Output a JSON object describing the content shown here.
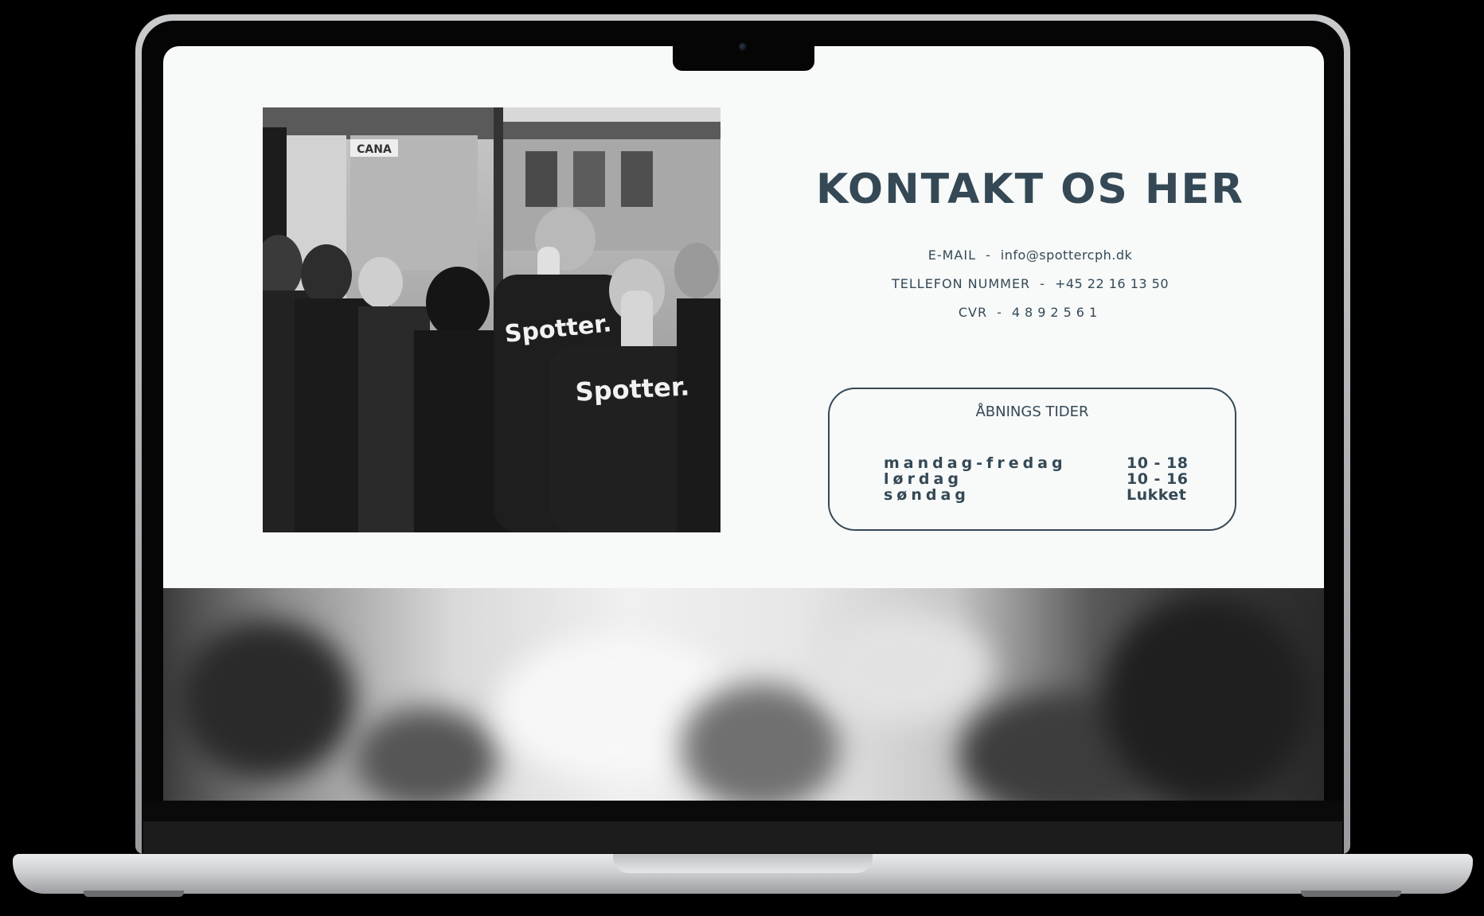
{
  "contact": {
    "title": "KONTAKT OS HER",
    "email_label": "E-MAIL",
    "email_value": "info@spottercph.dk",
    "phone_label": "TELLEFON NUMMER",
    "phone_value": "+45 22 16 13 50",
    "cvr_label": "CVR",
    "cvr_value": "4892561",
    "separator": "-"
  },
  "hours": {
    "title": "ÅBNINGS TIDER",
    "rows": [
      {
        "day": "mandag-fredag",
        "time": "10 - 18"
      },
      {
        "day": "lørdag",
        "time": "10 - 16"
      },
      {
        "day": "søndag",
        "time": "Lukket"
      }
    ]
  },
  "photo": {
    "jacket_text": "Spotter.",
    "sign_text": "CANA"
  },
  "colors": {
    "accent": "#344955",
    "page_background": "#f8f9f9"
  }
}
